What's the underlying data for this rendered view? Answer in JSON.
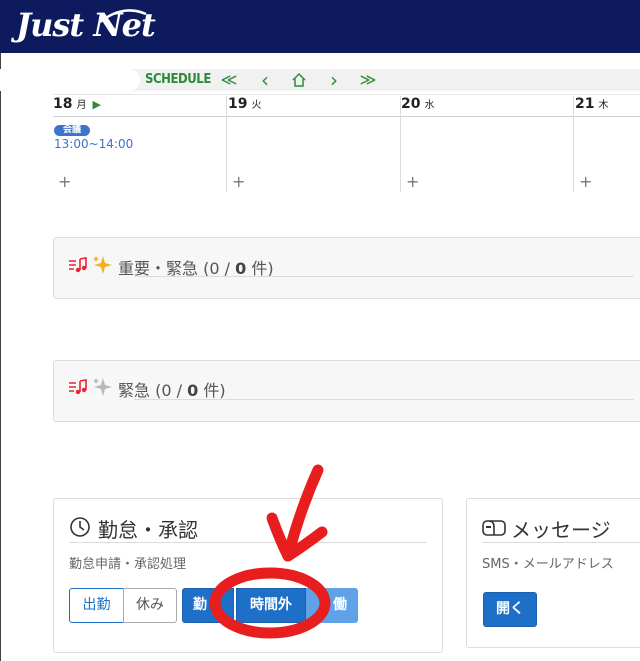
{
  "header": {
    "logo_text": "Just Net"
  },
  "schedule": {
    "title": "SCHEDULE",
    "nav": {
      "first": "≪",
      "prev": "‹",
      "home": "⌂",
      "next": "›",
      "last": "≫"
    },
    "days": [
      {
        "date": "18",
        "weekday": "月",
        "today_marker": "▶"
      },
      {
        "date": "19",
        "weekday": "火"
      },
      {
        "date": "20",
        "weekday": "水"
      },
      {
        "date": "21",
        "weekday": "木"
      }
    ],
    "event": {
      "label": "会議",
      "time": "13:00~14:00"
    },
    "add_symbol": "+"
  },
  "tasks": {
    "important_urgent": {
      "label": "重要・緊急",
      "done": "0",
      "total": "0",
      "unit": "件"
    },
    "urgent": {
      "label": "緊急",
      "done": "0",
      "total": "0",
      "unit": "件"
    }
  },
  "attendance": {
    "title": "勤怠・承認",
    "subtitle": "勤怠申請・承認処理",
    "buttons": {
      "clock_in": "出勤",
      "rest": "休み",
      "work": "勤",
      "overtime": "時間外",
      "labor": "働"
    }
  },
  "message": {
    "title": "メッセージ",
    "subtitle": "SMS・メールアドレス",
    "open_button": "開く"
  },
  "colors": {
    "header_bg": "#0d1b5e",
    "schedule_green": "#2e8b3a",
    "primary_blue": "#1e6fc7",
    "annotation_red": "#e81e1e"
  }
}
